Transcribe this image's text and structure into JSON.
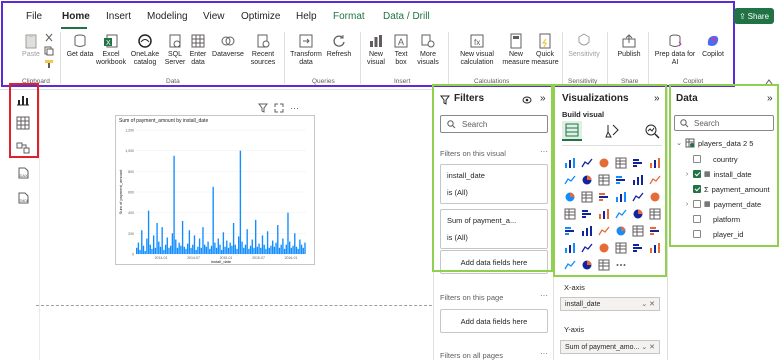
{
  "ribbon": {
    "tabs": [
      "File",
      "Home",
      "Insert",
      "Modeling",
      "View",
      "Optimize",
      "Help",
      "Format",
      "Data / Drill"
    ],
    "share_label": "Share",
    "buttons": {
      "paste": "Paste",
      "get_data": "Get data",
      "excel": "Excel workbook",
      "onelake": "OneLake catalog",
      "sql": "SQL Server",
      "enter_data": "Enter data",
      "dataverse": "Dataverse",
      "recent": "Recent sources",
      "transform": "Transform data",
      "refresh": "Refresh",
      "new_visual": "New visual",
      "text_box": "Text box",
      "more_visuals": "More visuals",
      "new_visual_calc": "New visual calculation",
      "new_measure": "New measure",
      "quick_measure": "Quick measure",
      "sensitivity": "Sensitivity",
      "publish": "Publish",
      "prep_copilot": "Prep data for AI",
      "copilot": "Copilot"
    },
    "groups": [
      "Clipboard",
      "Data",
      "Queries",
      "Insert",
      "Calculations",
      "Sensitivity",
      "Share",
      "Copilot"
    ]
  },
  "visual": {
    "title": "Sum of payment_amount by install_date",
    "ylabel": "Sum of payment_amount",
    "xlabel": "install_date",
    "yticks": [
      "1,200",
      "1,000",
      "800",
      "600",
      "400",
      "200",
      "0"
    ],
    "xticks": [
      "2014-01",
      "2014-07",
      "2015-01",
      "2015-07",
      "2016-01"
    ]
  },
  "chart_data": {
    "type": "bar",
    "title": "Sum of payment_amount by install_date",
    "xlabel": "install_date",
    "ylabel": "Sum of payment_amount",
    "ylim": [
      0,
      1200
    ],
    "color": "#118dff",
    "x_range": [
      "2014-01",
      "2016-01"
    ],
    "values": [
      60,
      110,
      40,
      230,
      80,
      30,
      150,
      420,
      90,
      50,
      180,
      60,
      300,
      120,
      70,
      260,
      40,
      90,
      160,
      60,
      80,
      200,
      950,
      140,
      60,
      110,
      80,
      320,
      70,
      50,
      100,
      230,
      60,
      90,
      180,
      40,
      70,
      150,
      60,
      260,
      90,
      70,
      120,
      50,
      80,
      650,
      110,
      60,
      150,
      90,
      40,
      210,
      70,
      130,
      60,
      110,
      80,
      300,
      90,
      50,
      170,
      1000,
      120,
      60,
      90,
      240,
      50,
      80,
      140,
      60,
      330,
      70,
      100,
      60,
      180,
      90,
      50,
      220,
      60,
      80,
      130,
      70,
      110,
      280,
      60,
      90,
      150,
      50,
      90,
      400,
      120,
      60,
      80,
      200,
      70,
      50,
      140,
      90,
      60,
      110
    ]
  },
  "filters": {
    "title": "Filters",
    "search_placeholder": "Search",
    "on_visual_label": "Filters on this visual",
    "card1_name": "install_date",
    "card1_value": "is (All)",
    "card2_name": "Sum of payment_a...",
    "card2_value": "is (All)",
    "add_fields": "Add data fields here",
    "on_page_label": "Filters on this page",
    "add_fields_page": "Add data fields here",
    "on_all_label": "Filters on all pages"
  },
  "viz": {
    "title": "Visualizations",
    "build_visual": "Build visual",
    "xaxis_label": "X-axis",
    "xaxis_value": "install_date",
    "yaxis_label": "Y-axis",
    "yaxis_value": "Sum of payment_amo..."
  },
  "data_pane": {
    "title": "Data",
    "search_placeholder": "Search",
    "table_name": "players_data 2 5",
    "fields": [
      {
        "name": "country",
        "checked": false,
        "expandable": false
      },
      {
        "name": "install_date",
        "checked": true,
        "expandable": true
      },
      {
        "name": "payment_amount",
        "checked": true,
        "expandable": false
      },
      {
        "name": "payment_date",
        "checked": false,
        "expandable": true
      },
      {
        "name": "platform",
        "checked": false,
        "expandable": false
      },
      {
        "name": "player_id",
        "checked": false,
        "expandable": false
      }
    ]
  }
}
